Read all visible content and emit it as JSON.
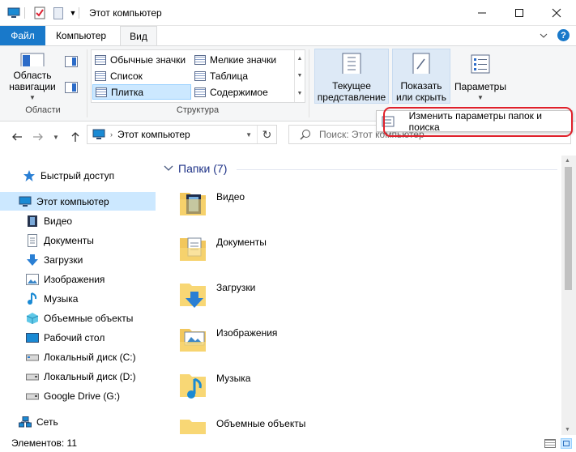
{
  "window": {
    "title": "Этот компьютер"
  },
  "tabs": {
    "file": "Файл",
    "computer": "Компьютер",
    "view": "Вид"
  },
  "ribbon": {
    "nav_area_line1": "Область",
    "nav_area_line2": "навигации",
    "group_areas": "Области",
    "layouts": [
      "Обычные значки",
      "Мелкие значки",
      "Список",
      "Таблица",
      "Плитка",
      "Содержимое"
    ],
    "group_structure": "Структура",
    "current_view_line1": "Текущее",
    "current_view_line2": "представление",
    "show_hide_line1": "Показать",
    "show_hide_line2": "или скрыть",
    "options": "Параметры"
  },
  "popup": {
    "label": "Изменить параметры папок и поиска"
  },
  "address": {
    "path": "Этот компьютер",
    "search_placeholder": "Поиск: Этот компьютер"
  },
  "nav": [
    {
      "label": "Быстрый доступ",
      "icon": "star-icon"
    },
    {
      "label": "Этот компьютер",
      "icon": "computer-icon"
    },
    {
      "label": "Видео",
      "icon": "video-icon"
    },
    {
      "label": "Документы",
      "icon": "documents-icon"
    },
    {
      "label": "Загрузки",
      "icon": "download-icon"
    },
    {
      "label": "Изображения",
      "icon": "pictures-icon"
    },
    {
      "label": "Музыка",
      "icon": "music-icon"
    },
    {
      "label": "Объемные объекты",
      "icon": "3d-objects-icon"
    },
    {
      "label": "Рабочий стол",
      "icon": "desktop-icon"
    },
    {
      "label": "Локальный диск (C:)",
      "icon": "drive-icon"
    },
    {
      "label": "Локальный диск (D:)",
      "icon": "drive-icon"
    },
    {
      "label": "Google Drive (G:)",
      "icon": "drive-icon"
    },
    {
      "label": "Сеть",
      "icon": "network-icon"
    }
  ],
  "content": {
    "group_title": "Папки (7)",
    "folders": [
      "Видео",
      "Документы",
      "Загрузки",
      "Изображения",
      "Музыка",
      "Объемные объекты"
    ]
  },
  "status": {
    "count": "Элементов: 11"
  },
  "colors": {
    "accent": "#1979ca",
    "selection": "#cce8ff",
    "highlight_border": "#e0202a",
    "folder": "#f8d775",
    "group_title": "#1e3287"
  }
}
